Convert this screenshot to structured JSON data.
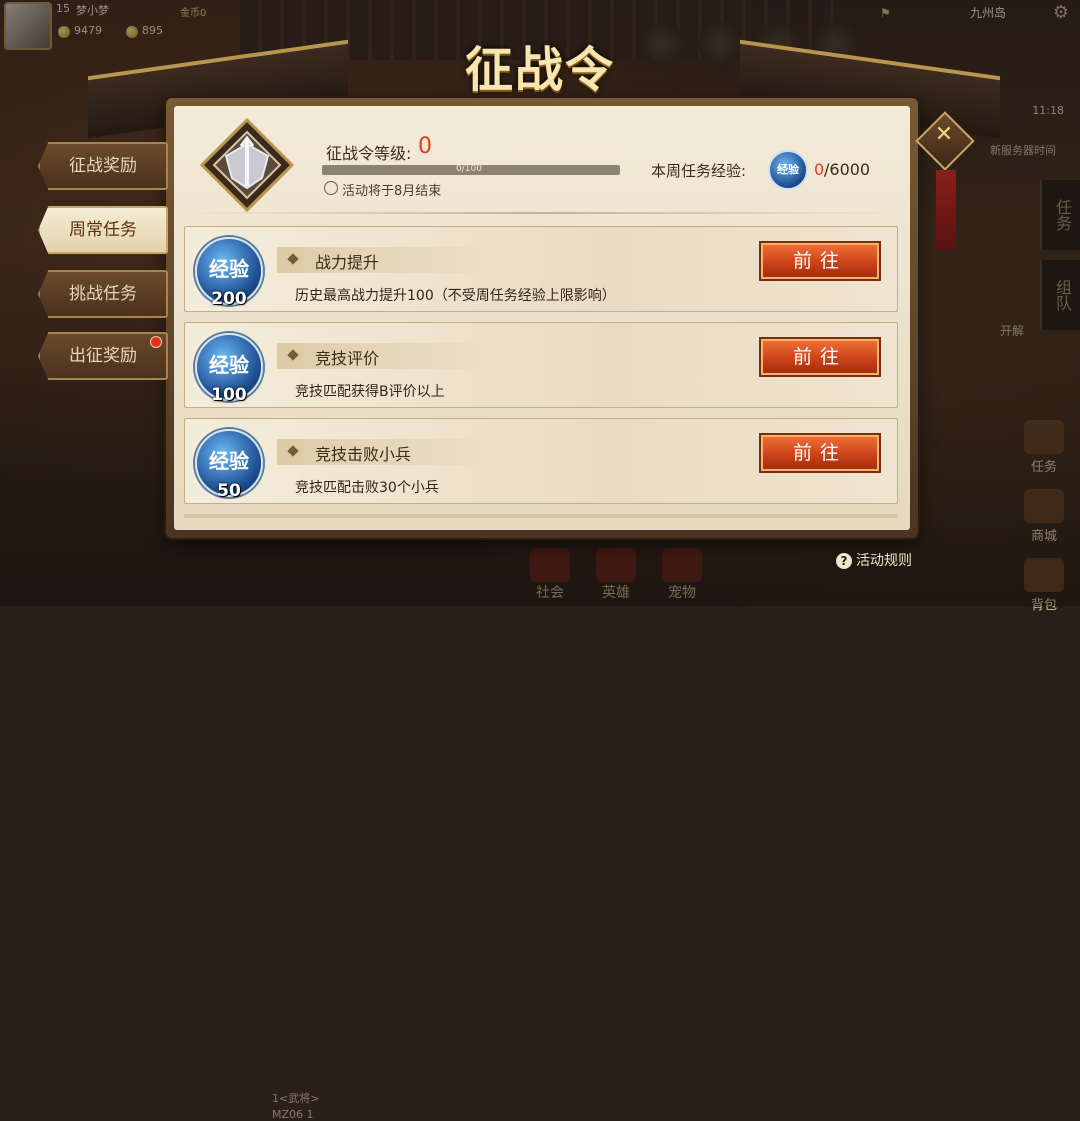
{
  "player": {
    "level": "15",
    "name": "梦小梦",
    "gold_label": "金币0",
    "coins": [
      "9479",
      "895"
    ]
  },
  "region": "九州岛",
  "clock": "11:18",
  "server_time": "新服务器时间",
  "open_hint": "开解",
  "side_right": [
    "任务",
    "组队"
  ],
  "title": "征战令",
  "level": {
    "label": "征战令等级:",
    "value": "0",
    "progress_text": "0/100",
    "progress": 0
  },
  "end_text": "活动将于8月结束",
  "weekly": {
    "label": "本周任务经验:",
    "badge": "经验",
    "current": "0",
    "total": "/6000"
  },
  "tabs": [
    {
      "label": "征战奖励"
    },
    {
      "label": "周常任务"
    },
    {
      "label": "挑战任务"
    },
    {
      "label": "出征奖励"
    }
  ],
  "tasks": [
    {
      "badge": "经验",
      "exp": "200",
      "name": "战力提升",
      "desc": "历史最高战力提升100（不受周任务经验上限影响）",
      "button": "前往"
    },
    {
      "badge": "经验",
      "exp": "100",
      "name": "竞技评价",
      "desc": "竞技匹配获得B评价以上",
      "button": "前往"
    },
    {
      "badge": "经验",
      "exp": "50",
      "name": "竞技击败小兵",
      "desc": "竞技匹配击败30个小兵",
      "button": "前往"
    }
  ],
  "rules": "活动规则",
  "chat": [
    "1<武将>",
    "MZ06 1"
  ],
  "bottom_nav": [
    "社会",
    "英雄",
    "宠物"
  ],
  "right_col": [
    "任务",
    "商城",
    "背包"
  ],
  "colors": {
    "accent_red": "#d8401c",
    "button": "#c93f18",
    "gold": "#b9964f"
  }
}
